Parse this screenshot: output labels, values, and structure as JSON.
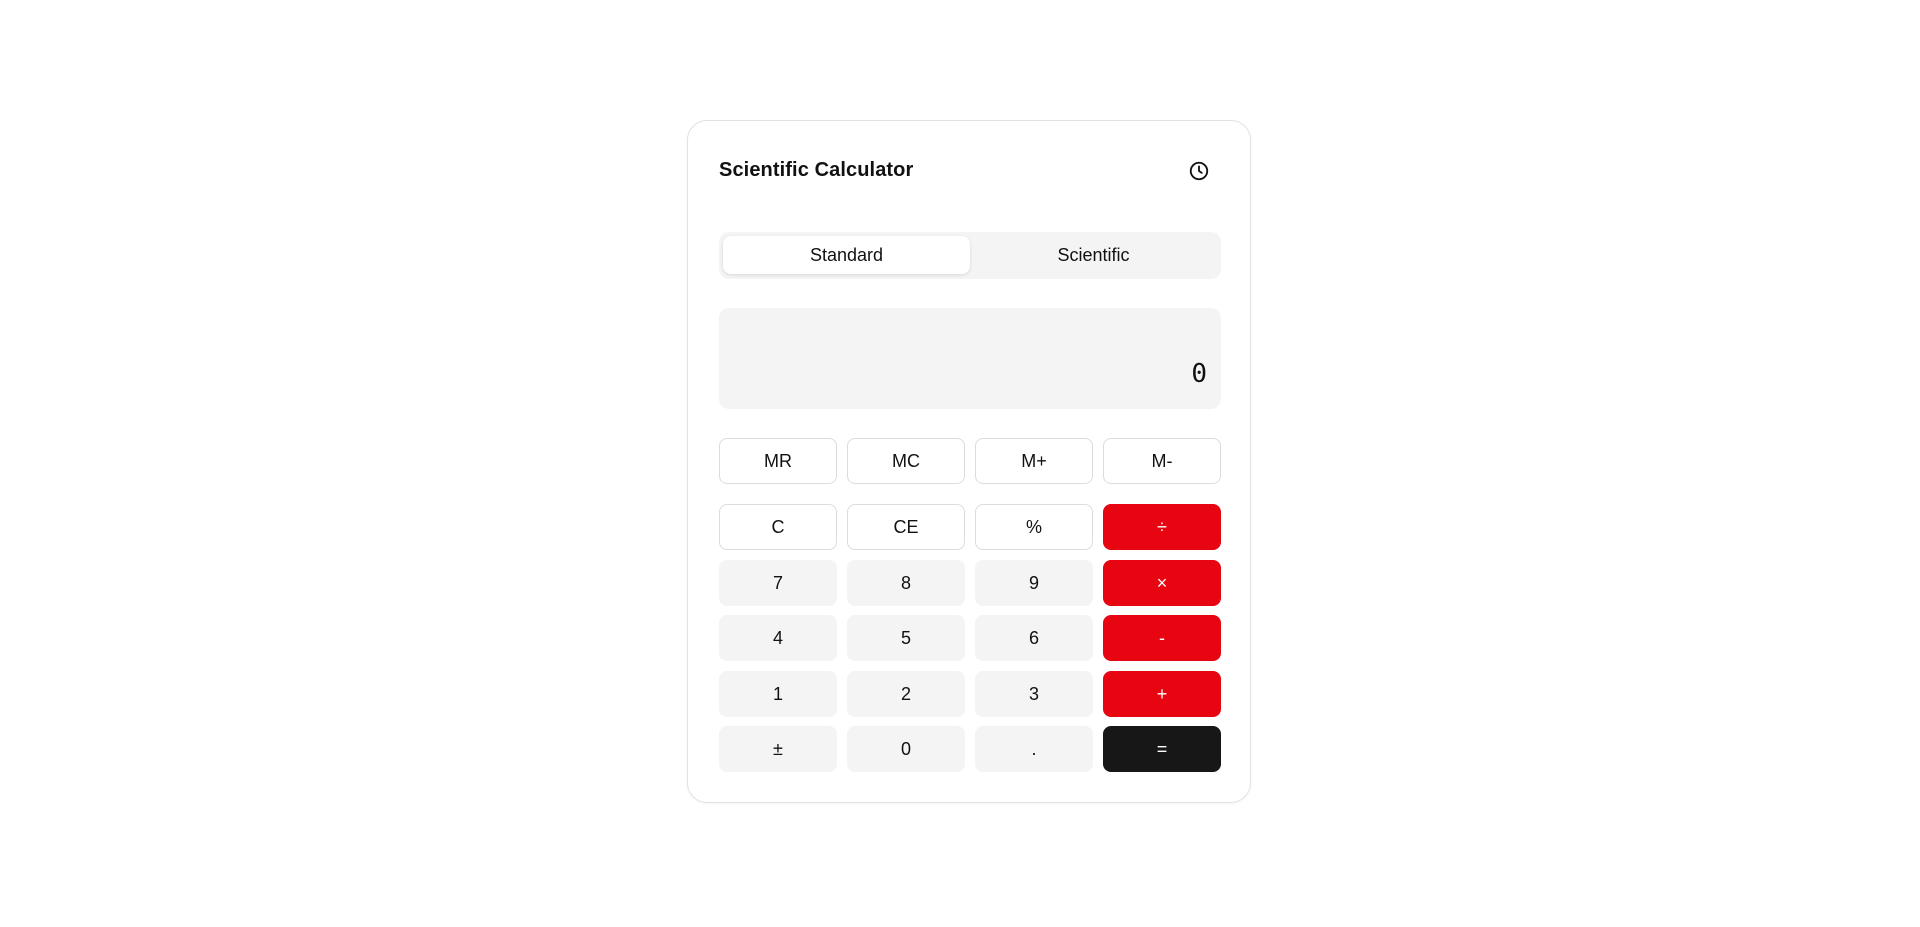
{
  "app": {
    "title": "Scientific Calculator",
    "history_icon": "clock-icon"
  },
  "tabs": [
    {
      "label": "Standard",
      "active": true
    },
    {
      "label": "Scientific",
      "active": false
    }
  ],
  "display": {
    "value": "0"
  },
  "memory": [
    {
      "label": "MR"
    },
    {
      "label": "MC"
    },
    {
      "label": "M+"
    },
    {
      "label": "M-"
    }
  ],
  "keys": {
    "clear": "C",
    "clear_entry": "CE",
    "percent": "%",
    "divide": "÷",
    "seven": "7",
    "eight": "8",
    "nine": "9",
    "multiply": "×",
    "four": "4",
    "five": "5",
    "six": "6",
    "subtract": "-",
    "one": "1",
    "two": "2",
    "three": "3",
    "add": "+",
    "negate": "±",
    "zero": "0",
    "decimal": ".",
    "equals": "="
  },
  "colors": {
    "operator": "#e60511",
    "equals": "#171717",
    "key_background": "#f4f4f4"
  }
}
